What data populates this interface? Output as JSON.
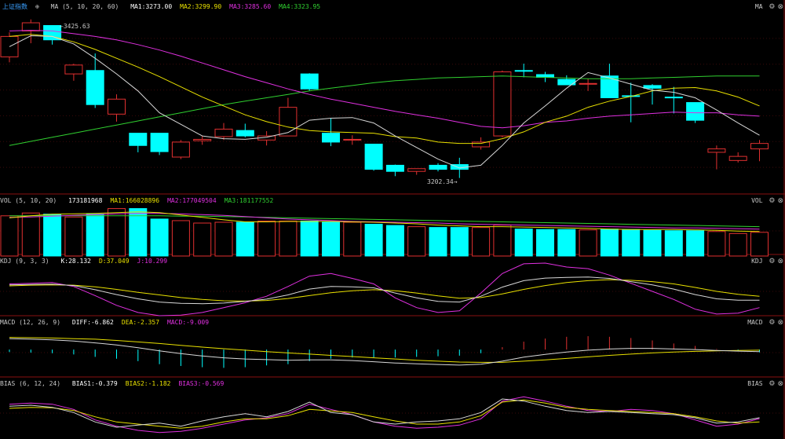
{
  "panels": {
    "price": {
      "title": "上证指数",
      "indicator": "MA (5, 10, 20, 60)",
      "items": [
        {
          "label": "MA1:",
          "value": "3273.00",
          "color": "#ffffff"
        },
        {
          "label": "MA2:",
          "value": "3299.90",
          "color": "#e8e000"
        },
        {
          "label": "MA3:",
          "value": "3285.60",
          "color": "#e030e0"
        },
        {
          "label": "MA4:",
          "value": "3323.95",
          "color": "#30d030"
        }
      ],
      "tag": "MA",
      "high_label": "3425.63",
      "low_label": "3202.34"
    },
    "vol": {
      "indicator": "VOL (5, 10, 20)",
      "items": [
        {
          "label": "",
          "value": "173181968",
          "color": "#ffffff"
        },
        {
          "label": "MA1:",
          "value": "166028896",
          "color": "#e8e000"
        },
        {
          "label": "MA2:",
          "value": "177049504",
          "color": "#e030e0"
        },
        {
          "label": "MA3:",
          "value": "181177552",
          "color": "#30d030"
        }
      ],
      "tag": "VOL"
    },
    "kdj": {
      "indicator": "KDJ (9, 3, 3)",
      "items": [
        {
          "label": "K:",
          "value": "28.132",
          "color": "#ffffff"
        },
        {
          "label": "D:",
          "value": "37.049",
          "color": "#e8e000"
        },
        {
          "label": "J:",
          "value": "10.299",
          "color": "#e030e0"
        }
      ],
      "tag": "KDJ"
    },
    "macd": {
      "indicator": "MACD (12, 26, 9)",
      "items": [
        {
          "label": "DIFF:",
          "value": "-6.862",
          "color": "#ffffff"
        },
        {
          "label": "DEA:",
          "value": "-2.357",
          "color": "#e8e000"
        },
        {
          "label": "MACD:",
          "value": "-9.009",
          "color": "#e030e0"
        }
      ],
      "tag": "MACD"
    },
    "bias": {
      "indicator": "BIAS (6, 12, 24)",
      "items": [
        {
          "label": "BIAS1:",
          "value": "-0.379",
          "color": "#ffffff"
        },
        {
          "label": "BIAS2:",
          "value": "-1.182",
          "color": "#e8e000"
        },
        {
          "label": "BIAS3:",
          "value": "-0.569",
          "color": "#e030e0"
        }
      ],
      "tag": "BIAS"
    }
  },
  "chart_data": {
    "type": "candlestick",
    "up_color": "#e03030",
    "down_color": "#00ffff",
    "ylim": [
      3180,
      3445
    ],
    "candles": [
      {
        "o": 3380,
        "c": 3410,
        "h": 3416,
        "l": 3372
      },
      {
        "o": 3418,
        "c": 3430,
        "h": 3435,
        "l": 3400
      },
      {
        "o": 3426,
        "c": 3405,
        "h": 3426,
        "l": 3398
      },
      {
        "o": 3355,
        "c": 3368,
        "h": 3370,
        "l": 3345
      },
      {
        "o": 3360,
        "c": 3310,
        "h": 3385,
        "l": 3305
      },
      {
        "o": 3296,
        "c": 3318,
        "h": 3325,
        "l": 3285
      },
      {
        "o": 3268,
        "c": 3250,
        "h": 3268,
        "l": 3240
      },
      {
        "o": 3268,
        "c": 3241,
        "h": 3268,
        "l": 3236
      },
      {
        "o": 3233,
        "c": 3255,
        "h": 3258,
        "l": 3230
      },
      {
        "o": 3257,
        "c": 3259,
        "h": 3264,
        "l": 3251
      },
      {
        "o": 3263,
        "c": 3274,
        "h": 3283,
        "l": 3258
      },
      {
        "o": 3272,
        "c": 3264,
        "h": 3282,
        "l": 3262
      },
      {
        "o": 3258,
        "c": 3264,
        "h": 3271,
        "l": 3250
      },
      {
        "o": 3264,
        "c": 3306,
        "h": 3320,
        "l": 3264
      },
      {
        "o": 3355,
        "c": 3333,
        "h": 3356,
        "l": 3330
      },
      {
        "o": 3268,
        "c": 3255,
        "h": 3290,
        "l": 3249
      },
      {
        "o": 3259,
        "c": 3259,
        "h": 3265,
        "l": 3251
      },
      {
        "o": 3252,
        "c": 3215,
        "h": 3252,
        "l": 3213
      },
      {
        "o": 3221,
        "c": 3212,
        "h": 3222,
        "l": 3205
      },
      {
        "o": 3212,
        "c": 3216,
        "h": 3216,
        "l": 3207
      },
      {
        "o": 3221,
        "c": 3215,
        "h": 3224,
        "l": 3212
      },
      {
        "o": 3222,
        "c": 3215,
        "h": 3232,
        "l": 3202.34
      },
      {
        "o": 3248,
        "c": 3255,
        "h": 3262,
        "l": 3244
      },
      {
        "o": 3264,
        "c": 3358,
        "h": 3360,
        "l": 3262
      },
      {
        "o": 3360,
        "c": 3359,
        "h": 3370,
        "l": 3350
      },
      {
        "o": 3354,
        "c": 3350,
        "h": 3358,
        "l": 3343
      },
      {
        "o": 3347,
        "c": 3339,
        "h": 3353,
        "l": 3339
      },
      {
        "o": 3340,
        "c": 3341,
        "h": 3348,
        "l": 3330
      },
      {
        "o": 3352,
        "c": 3320,
        "h": 3370,
        "l": 3320
      },
      {
        "o": 3323,
        "c": 3322,
        "h": 3342,
        "l": 3284
      },
      {
        "o": 3338,
        "c": 3334,
        "h": 3340,
        "l": 3310
      },
      {
        "o": 3321,
        "c": 3320,
        "h": 3336,
        "l": 3297
      },
      {
        "o": 3313,
        "c": 3287,
        "h": 3313,
        "l": 3283
      },
      {
        "o": 3240,
        "c": 3245,
        "h": 3250,
        "l": 3215
      },
      {
        "o": 3228,
        "c": 3234,
        "h": 3240,
        "l": 3225
      },
      {
        "o": 3245,
        "c": 3253,
        "h": 3258,
        "l": 3227
      }
    ],
    "ma5": [
      3395,
      3411,
      3410,
      3399,
      3378,
      3355,
      3330,
      3298,
      3281,
      3264,
      3260,
      3259,
      3262,
      3269,
      3287,
      3290,
      3291,
      3283,
      3264,
      3247,
      3230,
      3217,
      3221,
      3250,
      3283,
      3308,
      3334,
      3357,
      3349,
      3340,
      3331,
      3328,
      3320,
      3302,
      3283,
      3265
    ],
    "ma10": [
      3410,
      3413,
      3410,
      3402,
      3391,
      3378,
      3365,
      3351,
      3336,
      3321,
      3308,
      3295,
      3285,
      3277,
      3272,
      3270,
      3269,
      3268,
      3263,
      3261,
      3255,
      3253,
      3253,
      3260,
      3270,
      3284,
      3293,
      3306,
      3315,
      3322,
      3330,
      3334,
      3335,
      3330,
      3321,
      3308
    ],
    "ma20": [
      3418,
      3419,
      3418,
      3414,
      3410,
      3405,
      3398,
      3390,
      3381,
      3371,
      3361,
      3351,
      3342,
      3333,
      3325,
      3318,
      3312,
      3306,
      3300,
      3295,
      3290,
      3284,
      3278,
      3276,
      3279,
      3284,
      3286,
      3290,
      3293,
      3295,
      3297,
      3299,
      3298,
      3298,
      3295,
      3293
    ],
    "ma60": [
      3250,
      3256,
      3262,
      3268,
      3274,
      3280,
      3286,
      3292,
      3298,
      3304,
      3310,
      3315,
      3320,
      3325,
      3330,
      3334,
      3338,
      3342,
      3345,
      3347,
      3349,
      3350,
      3351,
      3352,
      3351,
      3350,
      3349,
      3348,
      3348,
      3348,
      3349,
      3350,
      3351,
      3352,
      3352,
      3352
    ],
    "volume": [
      100,
      107,
      104,
      97,
      104,
      118,
      118,
      92,
      88,
      82,
      84,
      84,
      87,
      87,
      87,
      84,
      84,
      79,
      76,
      73,
      71,
      71,
      71,
      77,
      67,
      66,
      66,
      65,
      67,
      66,
      64,
      63,
      63,
      61,
      56,
      59
    ],
    "vol_ma": [
      [
        95,
        100,
        104,
        105,
        106,
        108,
        110,
        108,
        102,
        96,
        90,
        85,
        85,
        86,
        86,
        86,
        85,
        84,
        82,
        80,
        77,
        75,
        73,
        73,
        72,
        71,
        70,
        69,
        67,
        66,
        66,
        66,
        65,
        64,
        62,
        61
      ],
      [
        96,
        97,
        99,
        101,
        103,
        105,
        106,
        106,
        105,
        103,
        101,
        98,
        95,
        92,
        90,
        88,
        86,
        85,
        84,
        83,
        82,
        80,
        79,
        78,
        77,
        76,
        75,
        74,
        73,
        72,
        71,
        70,
        70,
        69,
        68,
        67
      ],
      [
        100,
        100,
        100,
        100,
        100,
        100,
        100,
        100,
        99,
        99,
        98,
        97,
        96,
        95,
        94,
        93,
        92,
        91,
        90,
        89,
        88,
        87,
        86,
        85,
        84,
        83,
        82,
        81,
        80,
        79,
        78,
        77,
        76,
        75,
        74,
        73
      ]
    ],
    "kdj": {
      "ylim": [
        -20,
        130
      ],
      "k": [
        75,
        76,
        77,
        73,
        60,
        45,
        32,
        22,
        18,
        17,
        19,
        24,
        31,
        44,
        62,
        70,
        69,
        66,
        50,
        35,
        24,
        22,
        40,
        68,
        88,
        96,
        98,
        99,
        95,
        85,
        75,
        62,
        45,
        32,
        28,
        28
      ],
      "d": [
        72,
        74,
        75,
        74,
        69,
        61,
        52,
        44,
        36,
        30,
        26,
        25,
        27,
        33,
        42,
        51,
        57,
        60,
        57,
        50,
        41,
        34,
        36,
        47,
        61,
        73,
        82,
        88,
        91,
        89,
        85,
        78,
        67,
        55,
        46,
        40
      ],
      "j": [
        78,
        80,
        82,
        70,
        42,
        12,
        -10,
        -20,
        -18,
        -10,
        5,
        20,
        40,
        70,
        102,
        110,
        95,
        78,
        35,
        5,
        -10,
        -5,
        50,
        110,
        140,
        142,
        130,
        125,
        105,
        80,
        55,
        30,
        0,
        -15,
        -12,
        5
      ]
    },
    "macd": {
      "ylim": [
        -90,
        70
      ],
      "diff": [
        36,
        34,
        32,
        28,
        22,
        15,
        6,
        -4,
        -13,
        -21,
        -27,
        -31,
        -33,
        -35,
        -34,
        -34,
        -36,
        -40,
        -44,
        -47,
        -49,
        -51,
        -48,
        -38,
        -25,
        -16,
        -8,
        -2,
        2,
        4,
        4,
        2,
        0,
        -3,
        -5,
        -7
      ],
      "dea": [
        40,
        39,
        38,
        36,
        34,
        30,
        25,
        20,
        14,
        8,
        3,
        -2,
        -7,
        -11,
        -15,
        -19,
        -23,
        -27,
        -31,
        -35,
        -38,
        -41,
        -42,
        -42,
        -38,
        -34,
        -29,
        -24,
        -19,
        -15,
        -11,
        -8,
        -6,
        -4,
        -3,
        -2
      ],
      "bar": [
        -8,
        -10,
        -12,
        -16,
        -24,
        -30,
        -38,
        -48,
        -54,
        -58,
        -60,
        -58,
        -52,
        -48,
        -38,
        -30,
        -26,
        -26,
        -26,
        -24,
        -22,
        -20,
        -12,
        8,
        26,
        36,
        42,
        44,
        42,
        38,
        30,
        20,
        12,
        2,
        -4,
        -9
      ]
    },
    "bias": {
      "ylim": [
        -4,
        5
      ],
      "b1": [
        1.8,
        2.0,
        1.6,
        0.6,
        -1.2,
        -2.2,
        -1.8,
        -1.4,
        -2.0,
        -1.0,
        -0.2,
        0.4,
        -0.2,
        0.8,
        2.6,
        0.6,
        0.2,
        -1.2,
        -1.6,
        -1.2,
        -1.0,
        -0.6,
        0.6,
        3.2,
        2.8,
        1.8,
        1.0,
        0.6,
        0.8,
        0.6,
        0.4,
        0.2,
        -0.4,
        -1.4,
        -1.2,
        -0.379
      ],
      "b2": [
        1.4,
        1.6,
        1.5,
        1.0,
        -0.2,
        -1.2,
        -1.6,
        -2.0,
        -2.4,
        -2.0,
        -1.2,
        -0.6,
        -0.6,
        0.0,
        1.2,
        0.9,
        0.6,
        -0.2,
        -1.0,
        -1.6,
        -1.6,
        -1.2,
        0.0,
        2.6,
        3.0,
        2.4,
        1.6,
        1.2,
        1.0,
        0.8,
        0.6,
        0.4,
        -0.2,
        -1.0,
        -1.4,
        -1.182
      ],
      "b3": [
        2.2,
        2.4,
        2.2,
        1.2,
        -0.8,
        -2.0,
        -2.8,
        -3.2,
        -3.0,
        -2.4,
        -1.6,
        -0.8,
        -0.4,
        0.4,
        2.2,
        1.2,
        0.2,
        -1.2,
        -2.0,
        -2.4,
        -2.2,
        -1.8,
        -0.6,
        2.8,
        3.6,
        2.8,
        1.8,
        1.0,
        0.8,
        1.2,
        1.0,
        0.4,
        -0.8,
        -2.0,
        -1.6,
        -0.569
      ]
    }
  }
}
